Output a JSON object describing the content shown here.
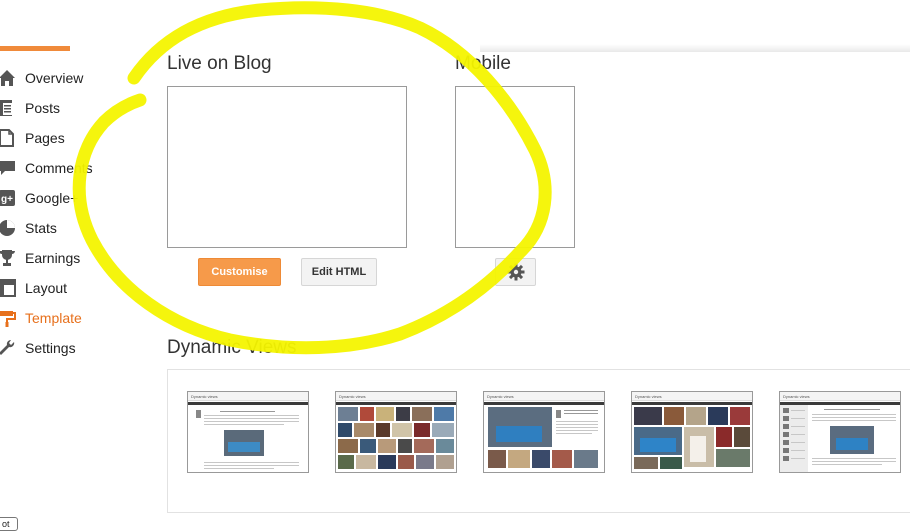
{
  "sidebar": {
    "items": [
      {
        "label": "Overview",
        "icon": "home-icon",
        "active": false
      },
      {
        "label": "Posts",
        "icon": "posts-icon",
        "active": false
      },
      {
        "label": "Pages",
        "icon": "pages-icon",
        "active": false
      },
      {
        "label": "Comments",
        "icon": "comments-icon",
        "active": false
      },
      {
        "label": "Google+",
        "icon": "google-plus-icon",
        "active": false
      },
      {
        "label": "Stats",
        "icon": "stats-icon",
        "active": false
      },
      {
        "label": "Earnings",
        "icon": "trophy-icon",
        "active": false
      },
      {
        "label": "Layout",
        "icon": "layout-icon",
        "active": false
      },
      {
        "label": "Template",
        "icon": "paint-roller-icon",
        "active": true
      },
      {
        "label": "Settings",
        "icon": "wrench-icon",
        "active": false
      }
    ]
  },
  "live": {
    "title": "Live on Blog",
    "customise_label": "Customise",
    "edit_html_label": "Edit HTML"
  },
  "mobile": {
    "title": "Mobile",
    "settings_icon": "gear-icon"
  },
  "dynamic_views": {
    "title": "Dynamic Views",
    "thumbnails": [
      {
        "name": "Dynamic views"
      },
      {
        "name": "Dynamic views"
      },
      {
        "name": "Dynamic views"
      },
      {
        "name": "Dynamic views"
      },
      {
        "name": "Dynamic views"
      }
    ]
  },
  "colors": {
    "accent_orange": "#f69a4a",
    "active_text": "#e7701c",
    "highlighter": "#f4f400"
  },
  "corner_fragment": "ot"
}
